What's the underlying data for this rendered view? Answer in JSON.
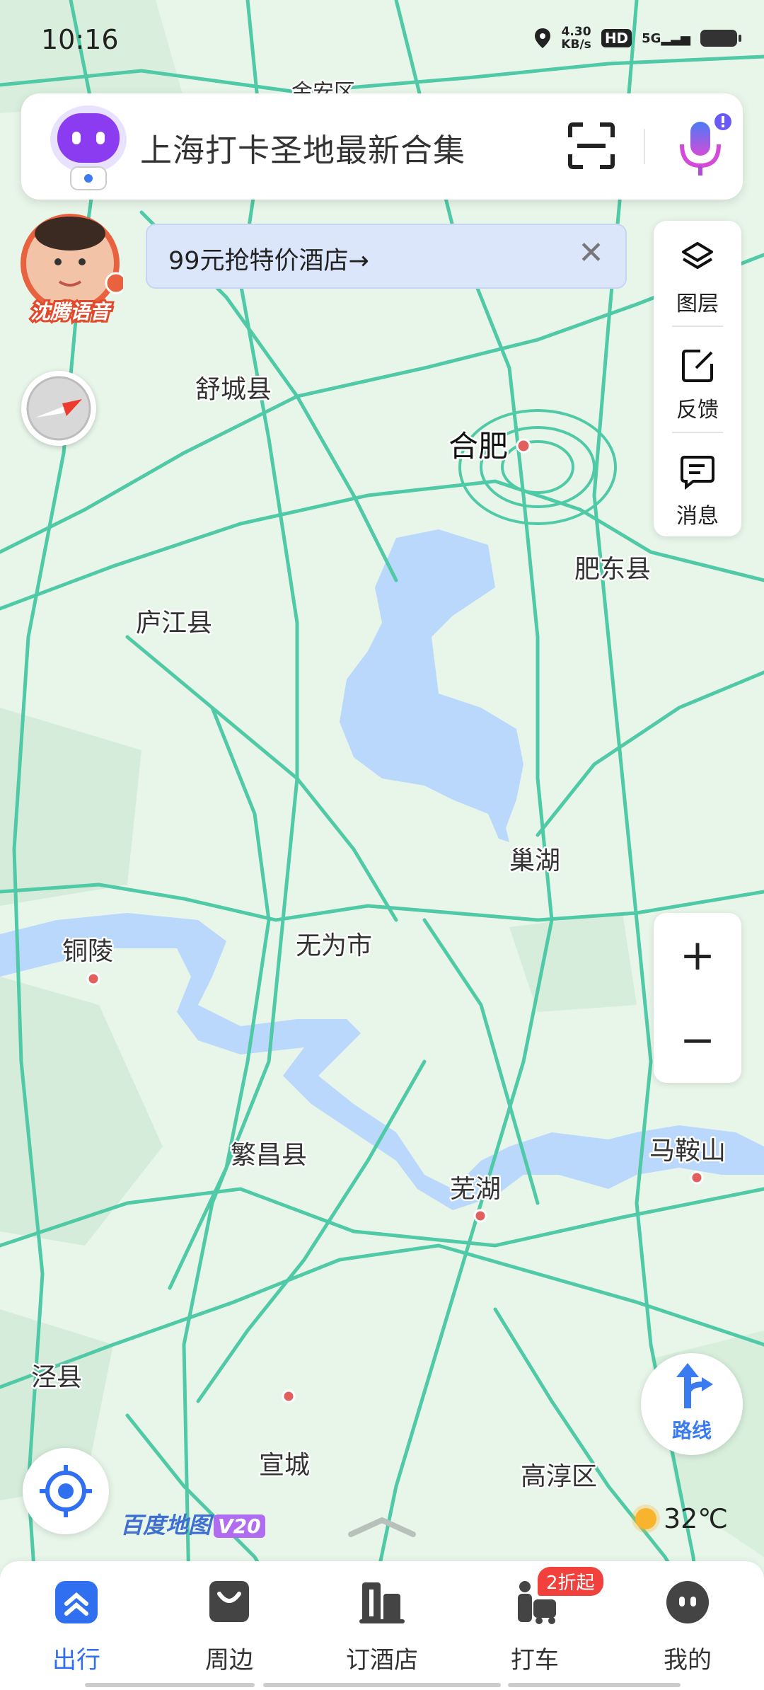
{
  "status_bar": {
    "time": "10:16",
    "speed_value": "4.30",
    "speed_unit": "KB/s",
    "hd": "HD",
    "network": "5G"
  },
  "search": {
    "text": "上海打卡圣地最新合集"
  },
  "voice_avatar": {
    "label": "沈腾语音"
  },
  "promo": {
    "text": "99元抢特价酒店→",
    "close": "✕"
  },
  "side_panel": {
    "layers": "图层",
    "feedback": "反馈",
    "messages": "消息"
  },
  "map": {
    "labels": [
      "合肥",
      "肥东县",
      "舒城县",
      "庐江县",
      "巢湖",
      "无为市",
      "铜陵",
      "繁昌县",
      "芜湖",
      "马鞍山",
      "泾县",
      "宣城",
      "高淳区",
      "金安区"
    ],
    "colors": {
      "land": "#e8f6ea",
      "road": "#4fc9a6",
      "water": "#b9d8fb"
    }
  },
  "zoom": {
    "in": "+",
    "out": "−"
  },
  "route": {
    "label": "路线"
  },
  "logo": {
    "name": "百度地图",
    "version": "V20"
  },
  "weather": {
    "temp": "32℃"
  },
  "tabs": [
    {
      "label": "出行"
    },
    {
      "label": "周边"
    },
    {
      "label": "订酒店"
    },
    {
      "label": "打车"
    },
    {
      "label": "我的"
    }
  ],
  "taxi_badge": "2折起"
}
